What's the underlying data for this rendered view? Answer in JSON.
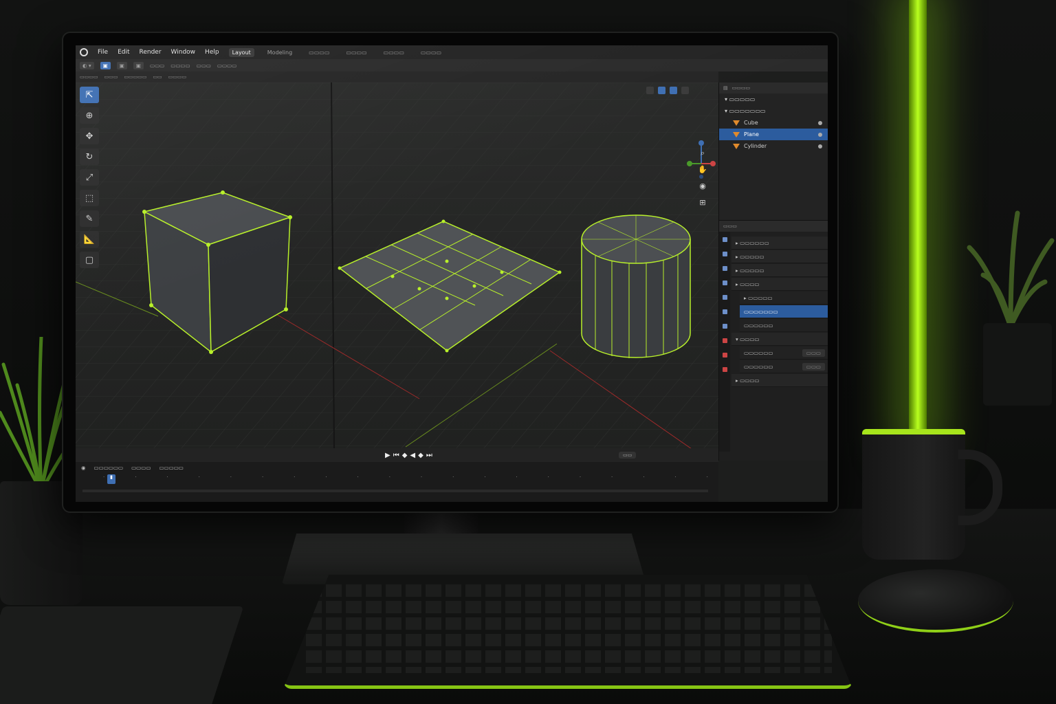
{
  "app": {
    "menu": [
      "File",
      "Edit",
      "Render",
      "Window",
      "Help"
    ],
    "workspaces": [
      "Layout",
      "Modeling"
    ],
    "active_workspace": "Layout"
  },
  "viewport": {
    "objects": [
      "Cube",
      "Plane",
      "Cylinder"
    ],
    "accent_color": "#b8f02a",
    "selection_color": "#3f6fb3"
  },
  "outliner": {
    "rows": [
      {
        "label": "Cube",
        "selected": false
      },
      {
        "label": "Plane",
        "selected": true
      },
      {
        "label": "Cylinder",
        "selected": false
      }
    ]
  },
  "icons": {
    "tools": [
      "select-box-icon",
      "cursor-icon",
      "move-icon",
      "rotate-icon",
      "scale-icon",
      "transform-icon",
      "annotate-icon",
      "measure-icon",
      "add-cube-icon"
    ],
    "gizmo": [
      "zoom-icon",
      "hand-icon",
      "camera-icon",
      "perspective-icon"
    ],
    "playback": [
      "play-icon",
      "jump-start-icon",
      "prev-keyframe-icon",
      "reverse-icon",
      "next-keyframe-icon",
      "jump-end-icon"
    ]
  }
}
